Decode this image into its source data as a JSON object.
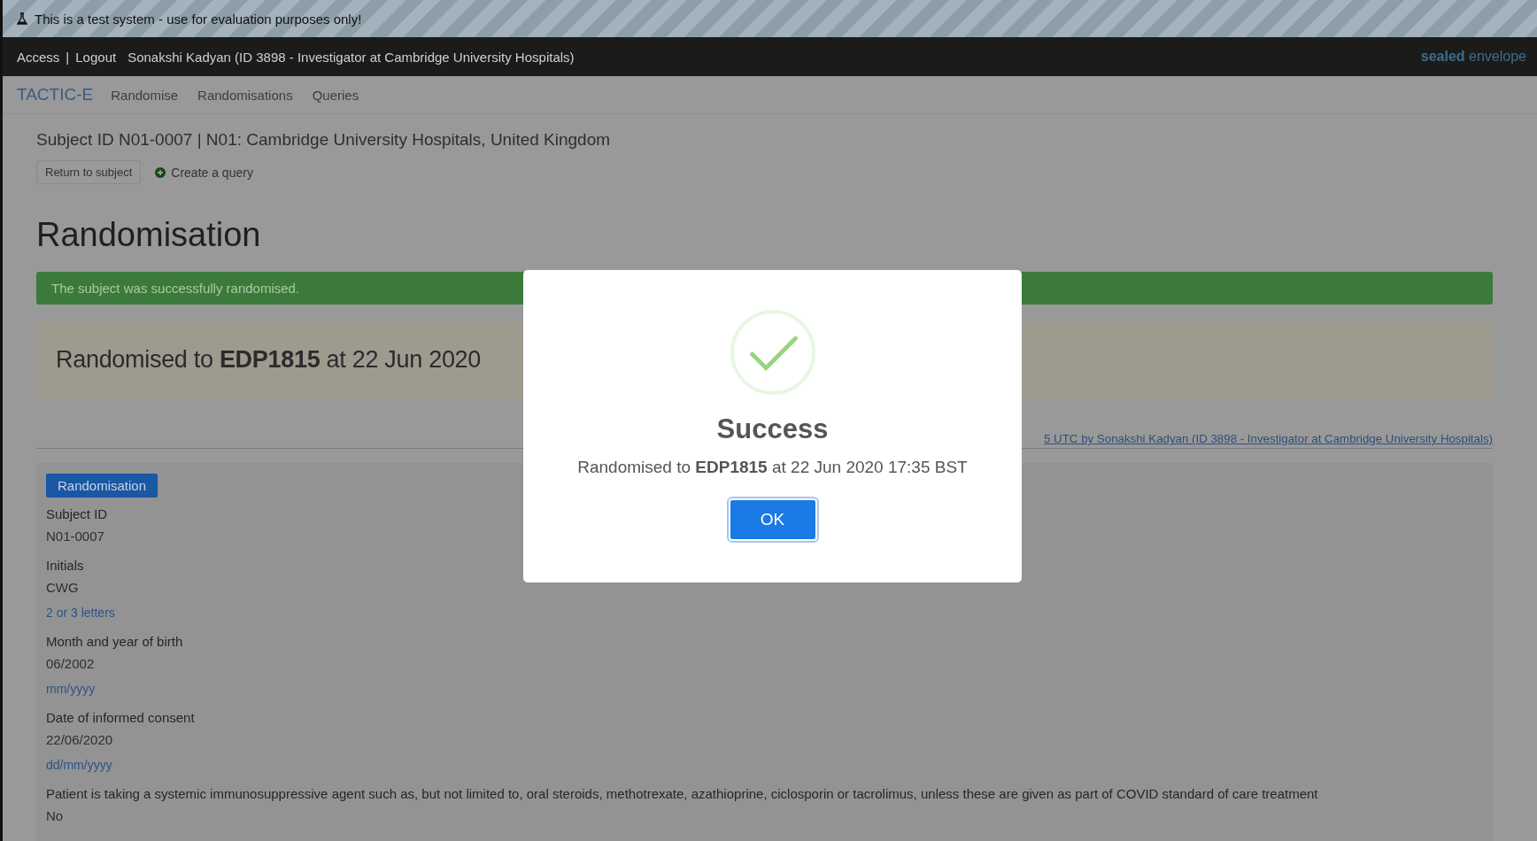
{
  "test_banner": {
    "text": "This is a test system - use for evaluation purposes only!"
  },
  "top_bar": {
    "links": [
      "Access",
      "Logout"
    ],
    "separator": "|",
    "user": "Sonakshi Kadyan (ID 3898 - Investigator at Cambridge University Hospitals)",
    "logo": [
      "sealed",
      "envelope"
    ]
  },
  "nav": {
    "brand": "TACTIC-E",
    "items": [
      {
        "label": "Randomise"
      },
      {
        "label": "Randomisations"
      },
      {
        "label": "Queries"
      }
    ]
  },
  "subject_heading": "Subject ID N01-0007 | N01: Cambridge University Hospitals, United Kingdom",
  "actions": {
    "return_button": "Return to subject",
    "create_query": "Create a query"
  },
  "page_title": "Randomisation",
  "alert": "The subject was successfully randomised.",
  "result_banner": "Randomised to **EDP1815** at 22 Jun 2020",
  "audit_link": "5 UTC by Sonakshi Kadyan (ID 3898 - Investigator at Cambridge University Hospitals)",
  "panel": {
    "tag": "Randomisation",
    "fields": [
      {
        "label": "Subject ID",
        "value": "N01-0007"
      },
      {
        "label": "Initials",
        "value": "CWG",
        "hint": "2 or 3 letters"
      },
      {
        "label": "Month and year of birth",
        "value": "06/2002",
        "hint": "mm/yyyy"
      },
      {
        "label": "Date of informed consent",
        "value": "22/06/2020",
        "hint": "dd/mm/yyyy"
      },
      {
        "label": "Patient is taking a systemic immunosuppressive agent such as, but not limited to, oral steroids, methotrexate, azathioprine, ciclosporin or tacrolimus, unless these are given as part of COVID standard of care treatment",
        "value": "No"
      }
    ]
  },
  "dialog": {
    "title": "Success",
    "message": "Randomised to **EDP1815** at 22 Jun 2020 17:35 BST",
    "button": "OK"
  }
}
